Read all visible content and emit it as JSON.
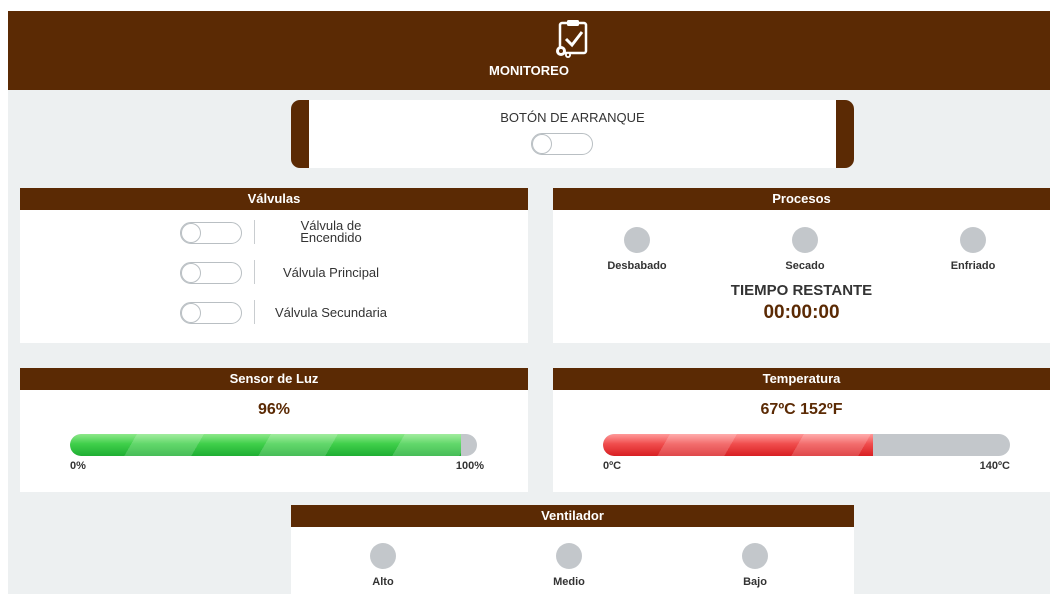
{
  "header": {
    "title": "MONITOREO",
    "icon": "clipboard-check-gear-icon"
  },
  "start": {
    "label": "BOTÓN DE ARRANQUE",
    "toggle_on": false
  },
  "valves": {
    "title": "Válvulas",
    "items": [
      {
        "line1": "Válvula de",
        "line2": "Encendido",
        "on": false
      },
      {
        "label": "Válvula Principal",
        "on": false
      },
      {
        "label": "Válvula Secundaria",
        "on": false
      }
    ]
  },
  "processes": {
    "title": "Procesos",
    "items": [
      {
        "label": "Desbabado"
      },
      {
        "label": "Secado"
      },
      {
        "label": "Enfriado"
      }
    ],
    "remaining_label": "TIEMPO RESTANTE",
    "remaining_time": "00:00:00"
  },
  "light": {
    "title": "Sensor de Luz",
    "value_text": "96%",
    "fraction": 0.96,
    "min_label": "0%",
    "max_label": "100%",
    "color": "#2bbf3f"
  },
  "temperature": {
    "title": "Temperatura",
    "value_text": "67ºC 152ºF",
    "fraction": 0.6643,
    "min_label": "0ºC",
    "max_label": "140ºC",
    "color": "#e8383a"
  },
  "fan": {
    "title": "Ventilador",
    "items": [
      {
        "label": "Alto"
      },
      {
        "label": "Medio"
      },
      {
        "label": "Bajo"
      }
    ]
  },
  "colors": {
    "brand": "#5b2a04",
    "background": "#edf0f1",
    "inactive_dot": "#c3c7cb"
  }
}
